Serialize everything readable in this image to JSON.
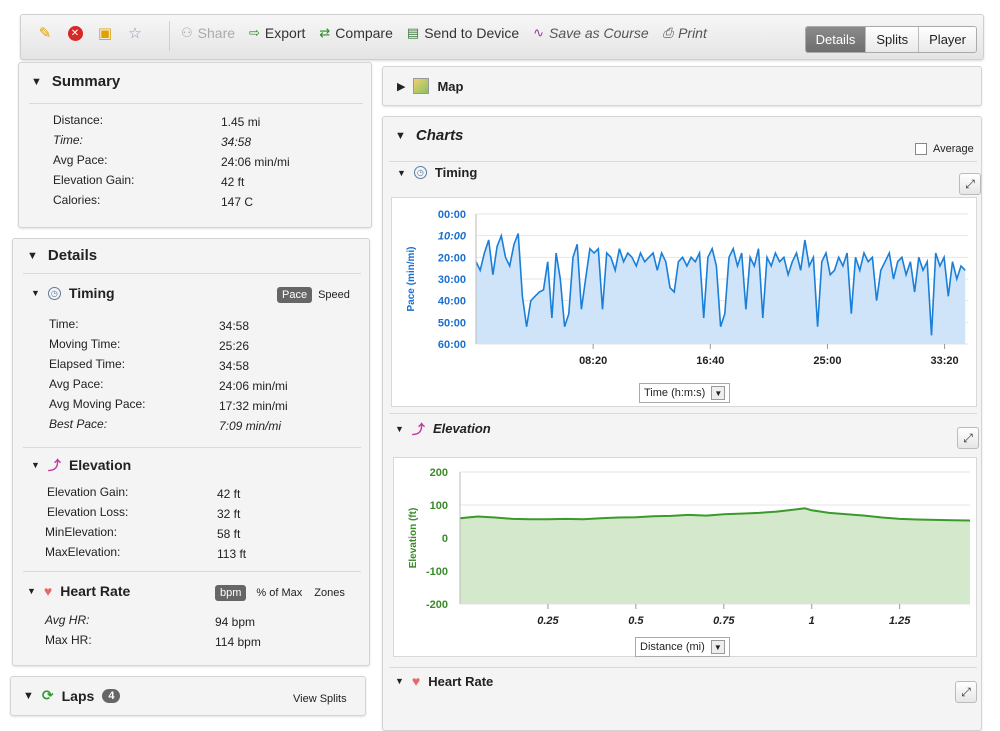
{
  "toolbar": {
    "icons": [
      "pencil-icon",
      "delete-icon",
      "lock-icon",
      "star-icon"
    ],
    "actions": [
      {
        "label": "Share",
        "icon": "share-icon",
        "disabled": true
      },
      {
        "label": "Export",
        "icon": "export-icon"
      },
      {
        "label": "Compare",
        "icon": "compare-icon"
      },
      {
        "label": "Send to Device",
        "icon": "device-icon"
      },
      {
        "label": "Save as Course",
        "icon": "course-icon",
        "italic": true
      },
      {
        "label": "Print",
        "icon": "print-icon",
        "italic": true
      }
    ],
    "views": [
      "Details",
      "Splits",
      "Player"
    ],
    "active_view": "Details"
  },
  "summary": {
    "title": "Summary",
    "rows": [
      {
        "label": "Distance:",
        "value": "1.45 mi"
      },
      {
        "label": "Time:",
        "value": "34:58"
      },
      {
        "label": "Avg Pace:",
        "value": "24:06 min/mi"
      },
      {
        "label": "Elevation Gain:",
        "value": "42 ft"
      },
      {
        "label": "Calories:",
        "value": "147 C"
      }
    ]
  },
  "details": {
    "title": "Details",
    "timing": {
      "title": "Timing",
      "toggle": [
        "Pace",
        "Speed"
      ],
      "rows": [
        {
          "label": "Time:",
          "value": "34:58"
        },
        {
          "label": "Moving Time:",
          "value": "25:26"
        },
        {
          "label": "Elapsed Time:",
          "value": "34:58"
        },
        {
          "label": "Avg Pace:",
          "value": "24:06 min/mi"
        },
        {
          "label": "Avg Moving Pace:",
          "value": "17:32 min/mi"
        },
        {
          "label": "Best Pace:",
          "value": "7:09 min/mi"
        }
      ]
    },
    "elevation": {
      "title": "Elevation",
      "rows": [
        {
          "label": "Elevation Gain:",
          "value": "42 ft"
        },
        {
          "label": "Elevation Loss:",
          "value": "32 ft"
        },
        {
          "label": "MinElevation:",
          "value": "58 ft"
        },
        {
          "label": "MaxElevation:",
          "value": "113 ft"
        }
      ]
    },
    "heart_rate": {
      "title": "Heart Rate",
      "toggle": [
        "bpm",
        "% of Max",
        "Zones"
      ],
      "rows": [
        {
          "label": "Avg HR:",
          "value": "94 bpm"
        },
        {
          "label": "Max HR:",
          "value": "114 bpm"
        }
      ]
    }
  },
  "laps": {
    "title": "Laps",
    "count": "4",
    "link": "View Splits"
  },
  "map": {
    "title": "Map"
  },
  "charts": {
    "title": "Charts",
    "average_label": "Average",
    "timing_title": "Timing",
    "elevation_title": "Elevation",
    "heart_rate_title": "Heart Rate",
    "timing_select": "Time (h:m:s)",
    "elevation_select": "Distance (mi)"
  },
  "chart_data": [
    {
      "type": "area",
      "ylabel": "Pace (min/mi)",
      "xlabel": "",
      "y_ticks": [
        "00:00",
        "10:00",
        "20:00",
        "30:00",
        "40:00",
        "50:00",
        "60:00"
      ],
      "x_ticks": [
        "08:20",
        "16:40",
        "25:00",
        "33:20"
      ],
      "ylim_minutes": [
        0,
        60
      ],
      "y_inverted": true,
      "xlim_minutes": [
        0,
        35
      ],
      "color": "#1a7fd8",
      "x_minutes": [
        0,
        0.3,
        0.6,
        0.9,
        1.2,
        1.5,
        1.8,
        2.1,
        2.4,
        2.7,
        3.0,
        3.3,
        3.6,
        3.9,
        4.2,
        4.5,
        4.8,
        5.1,
        5.4,
        5.7,
        6.0,
        6.3,
        6.6,
        6.9,
        7.2,
        7.5,
        7.8,
        8.1,
        8.4,
        8.7,
        9.0,
        9.3,
        9.6,
        9.9,
        10.2,
        10.5,
        10.8,
        11.1,
        11.4,
        11.7,
        12.0,
        12.3,
        12.6,
        12.9,
        13.2,
        13.5,
        13.8,
        14.1,
        14.4,
        14.7,
        15.0,
        15.3,
        15.6,
        15.9,
        16.2,
        16.5,
        16.8,
        17.1,
        17.4,
        17.7,
        18.0,
        18.3,
        18.6,
        18.9,
        19.2,
        19.5,
        19.8,
        20.1,
        20.4,
        20.7,
        21.0,
        21.3,
        21.6,
        21.9,
        22.2,
        22.5,
        22.8,
        23.1,
        23.4,
        23.7,
        24.0,
        24.3,
        24.6,
        24.9,
        25.2,
        25.5,
        25.8,
        26.1,
        26.4,
        26.7,
        27.0,
        27.3,
        27.6,
        27.9,
        28.2,
        28.5,
        28.8,
        29.1,
        29.4,
        29.7,
        30.0,
        30.3,
        30.6,
        30.9,
        31.2,
        31.5,
        31.8,
        32.1,
        32.4,
        32.7,
        33.0,
        33.3,
        33.6,
        33.9,
        34.2,
        34.5,
        34.8
      ],
      "pace_minutes": [
        22,
        26,
        18,
        12,
        28,
        15,
        10,
        20,
        24,
        14,
        9,
        38,
        52,
        40,
        38,
        36,
        35,
        22,
        48,
        18,
        30,
        52,
        46,
        20,
        14,
        44,
        30,
        16,
        18,
        16,
        44,
        18,
        20,
        26,
        16,
        22,
        18,
        20,
        24,
        18,
        22,
        20,
        18,
        26,
        18,
        22,
        34,
        36,
        22,
        20,
        24,
        20,
        22,
        18,
        48,
        20,
        16,
        24,
        52,
        46,
        20,
        16,
        24,
        18,
        44,
        20,
        24,
        16,
        48,
        20,
        24,
        18,
        22,
        20,
        28,
        22,
        18,
        26,
        12,
        24,
        20,
        52,
        22,
        18,
        28,
        26,
        20,
        24,
        18,
        46,
        20,
        26,
        18,
        22,
        20,
        40,
        26,
        22,
        18,
        30,
        22,
        20,
        28,
        22,
        36,
        20,
        26,
        22,
        56,
        18,
        24,
        20,
        38,
        22,
        30,
        24,
        26
      ]
    },
    {
      "type": "area",
      "ylabel": "Elevation (ft)",
      "xlabel": "",
      "x_ticks": [
        "0.25",
        "0.5",
        "0.75",
        "1",
        "1.25"
      ],
      "y_ticks": [
        "200",
        "100",
        "0",
        "-100",
        "-200"
      ],
      "ylim": [
        -200,
        200
      ],
      "xlim": [
        0,
        1.45
      ],
      "color": "#3a9a2a",
      "x": [
        0,
        0.05,
        0.1,
        0.15,
        0.2,
        0.25,
        0.3,
        0.35,
        0.4,
        0.45,
        0.5,
        0.55,
        0.6,
        0.65,
        0.7,
        0.75,
        0.8,
        0.85,
        0.9,
        0.95,
        0.98,
        1.0,
        1.05,
        1.1,
        1.15,
        1.2,
        1.25,
        1.3,
        1.35,
        1.4,
        1.45
      ],
      "y": [
        60,
        65,
        62,
        58,
        57,
        57,
        58,
        57,
        60,
        62,
        63,
        66,
        67,
        70,
        68,
        72,
        74,
        76,
        80,
        86,
        90,
        84,
        76,
        72,
        68,
        62,
        58,
        56,
        55,
        54,
        53
      ]
    }
  ]
}
